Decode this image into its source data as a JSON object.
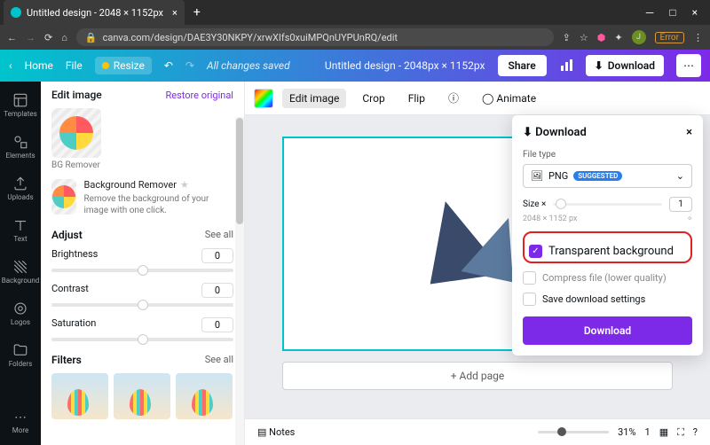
{
  "browser": {
    "tab_title": "Untitled design - 2048 × 1152px",
    "url": "canva.com/design/DAE3Y30NKPY/xrwXIfs0xuiMPQnUYPUnRQ/edit",
    "error_badge": "Error",
    "avatar_initial": "J"
  },
  "topbar": {
    "home": "Home",
    "file": "File",
    "resize": "Resize",
    "status": "All changes saved",
    "title": "Untitled design - 2048px × 1152px",
    "share": "Share",
    "download": "Download"
  },
  "rail": [
    {
      "label": "Templates"
    },
    {
      "label": "Elements"
    },
    {
      "label": "Uploads"
    },
    {
      "label": "Text"
    },
    {
      "label": "Background"
    },
    {
      "label": "Logos"
    },
    {
      "label": "Folders"
    },
    {
      "label": "More"
    }
  ],
  "panel": {
    "title": "Edit image",
    "restore": "Restore original",
    "bg_remover_label": "BG Remover",
    "bg_remover_title": "Background Remover",
    "bg_remover_desc": "Remove the background of your image with one click.",
    "adjust_title": "Adjust",
    "see_all": "See all",
    "adjust": [
      {
        "label": "Brightness",
        "value": "0"
      },
      {
        "label": "Contrast",
        "value": "0"
      },
      {
        "label": "Saturation",
        "value": "0"
      }
    ],
    "filters_title": "Filters"
  },
  "toolbar": {
    "edit_image": "Edit image",
    "crop": "Crop",
    "flip": "Flip",
    "animate": "Animate"
  },
  "canvas": {
    "add_page": "+ Add page"
  },
  "bottombar": {
    "notes": "Notes",
    "zoom": "31%",
    "page": "1"
  },
  "download": {
    "title": "Download",
    "filetype_label": "File type",
    "filetype": "PNG",
    "suggested": "SUGGESTED",
    "size_label": "Size ×",
    "size_value": "1",
    "dimensions": "2048 × 1152 px",
    "transparent": "Transparent background",
    "compress": "Compress file (lower quality)",
    "save_settings": "Save download settings",
    "button": "Download"
  }
}
